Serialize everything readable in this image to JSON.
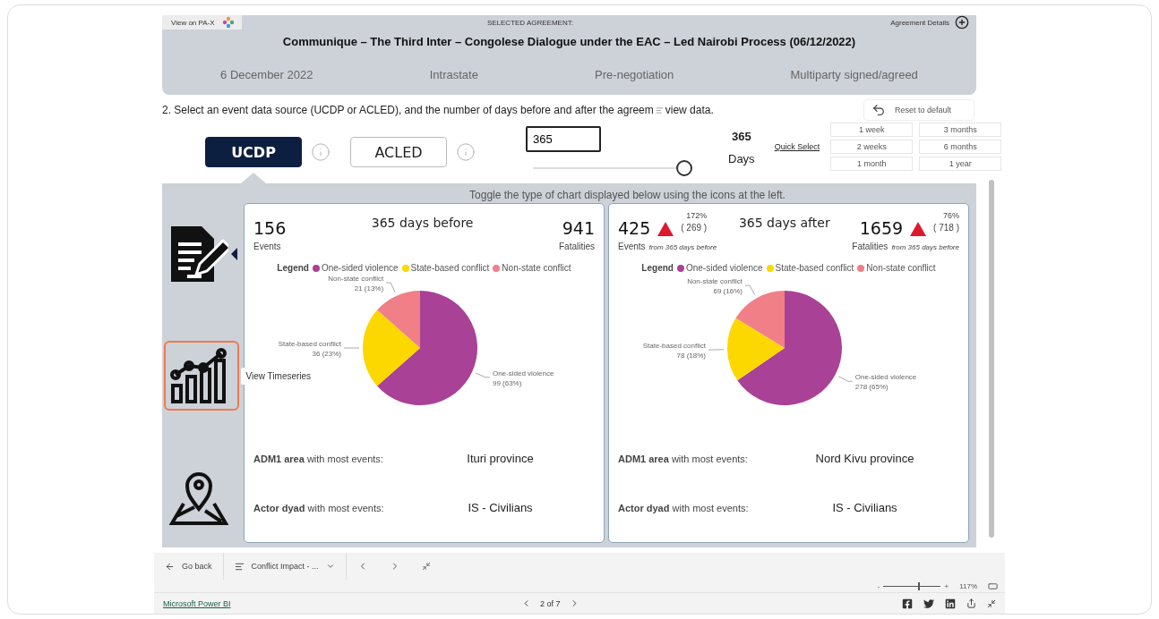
{
  "agreement": {
    "view_link": "View on PA-X",
    "caption": "SELECTED AGREEMENT:",
    "details_label": "Agreement Details",
    "title": "Communique – The Third Inter – Congolese Dialogue under the EAC – Led Nairobi Process (06/12/2022)",
    "facts": [
      "6 December 2022",
      "Intrastate",
      "Pre-negotiation",
      "Multiparty signed/agreed"
    ]
  },
  "instruction": {
    "text": "2. Select an event data source (UCDP or ACLED), and the number of days before and after the agreem",
    "tail": "view data."
  },
  "reset_button": "Reset to default",
  "sources": [
    {
      "label": "UCDP",
      "selected": true
    },
    {
      "label": "ACLED",
      "selected": false
    }
  ],
  "days": {
    "value": "365",
    "level": 1,
    "reading": "365",
    "unit": "Days",
    "quick_select": "Quick Select",
    "options": [
      "1 week",
      "3 months",
      "2 weeks",
      "6 months",
      "1 month",
      "1 year"
    ]
  },
  "toggle_hint": "Toggle the type of chart displayed below using the icons at the left.",
  "chart_types": [
    {
      "kind": "document",
      "selected": true,
      "hovered": false
    },
    {
      "kind": "timeseries",
      "selected": false,
      "hovered": true,
      "tooltip": "View Timeseries"
    },
    {
      "kind": "map",
      "selected": false,
      "hovered": false
    }
  ],
  "panels": [
    {
      "title": "365 days before",
      "legend": {
        "title": "Legend",
        "items": [
          {
            "label": "One-sided violence",
            "color": "#a94196"
          },
          {
            "label": "State-based conflict",
            "color": "#fcd700"
          },
          {
            "label": "Non-state conflict",
            "color": "#f07f87"
          }
        ]
      },
      "events": "156",
      "events_label": "Events",
      "fatalities": "941",
      "fatalities_label": "Fatalities",
      "chart_data": {
        "type": "pie",
        "categories": [
          "One-sided violence",
          "State-based conflict",
          "Non-state conflict"
        ],
        "values": [
          99,
          36,
          21
        ],
        "value_labels": [
          "99 (63%)",
          "36 (23%)",
          "21 (13%)"
        ]
      },
      "rows": [
        {
          "label": "**ADM1 area** with most events:",
          "value": "Ituri province"
        },
        {
          "label": "**Actor dyad** with most events:",
          "value": "IS - Civilians"
        }
      ]
    },
    {
      "title": "365 days after",
      "legend": {
        "title": "Legend",
        "items": [
          {
            "label": "One-sided violence",
            "color": "#a94196"
          },
          {
            "label": "State-based conflict",
            "color": "#fcd700"
          },
          {
            "label": "Non-state conflict",
            "color": "#f07f87"
          }
        ]
      },
      "events": "425",
      "events_label": "Events",
      "events_change": {
        "increase": true,
        "percent": "172%",
        "diff": "( 269 )",
        "note": "from 365 days before"
      },
      "fatalities": "1659",
      "fatalities_label": "Fatalities",
      "fatalities_change": {
        "increase": true,
        "percent": "76%",
        "diff": "( 718 )",
        "note": "from 365 days before"
      },
      "chart_data": {
        "type": "pie",
        "categories": [
          "One-sided violence",
          "State-based conflict",
          "Non-state conflict"
        ],
        "values": [
          278,
          78,
          69
        ],
        "value_labels": [
          "278 (65%)",
          "78 (18%)",
          "69 (16%)"
        ]
      },
      "rows": [
        {
          "label": "**ADM1 area** with most events:",
          "value": "Nord Kivu province"
        },
        {
          "label": "**Actor dyad** with most events:",
          "value": "IS - Civilians"
        }
      ]
    }
  ],
  "nav": {
    "back": "Go back",
    "page_menu": "Conflict Impact - ..."
  },
  "zoom": {
    "minus": "-",
    "plus": "+",
    "percent": "117%",
    "level": 0.6
  },
  "footer": {
    "brand": "Microsoft Power BI",
    "pager": "2 of 7"
  }
}
